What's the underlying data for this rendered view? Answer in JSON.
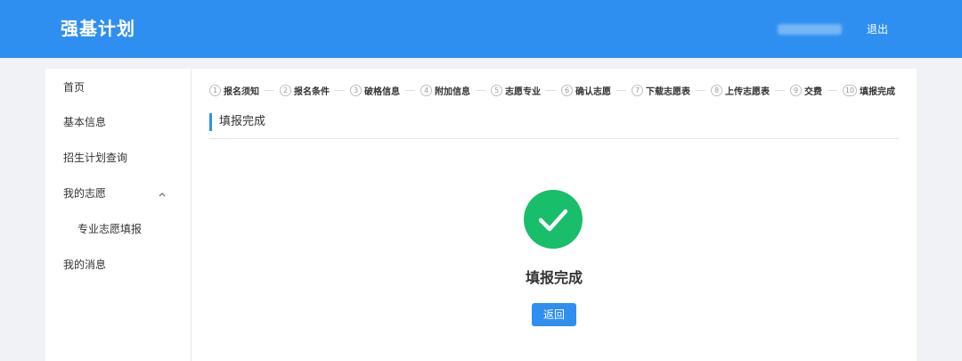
{
  "header": {
    "brand": "强基计划",
    "logout_label": "退出"
  },
  "sidebar": {
    "items": [
      {
        "label": "首页"
      },
      {
        "label": "基本信息"
      },
      {
        "label": "招生计划查询"
      },
      {
        "label": "我的志愿",
        "expanded": true
      },
      {
        "label": "专业志愿填报"
      },
      {
        "label": "我的消息"
      }
    ]
  },
  "steps": [
    {
      "num": "1",
      "label": "报名须知"
    },
    {
      "num": "2",
      "label": "报名条件"
    },
    {
      "num": "3",
      "label": "破格信息"
    },
    {
      "num": "4",
      "label": "附加信息"
    },
    {
      "num": "5",
      "label": "志愿专业"
    },
    {
      "num": "6",
      "label": "确认志愿"
    },
    {
      "num": "7",
      "label": "下载志愿表"
    },
    {
      "num": "8",
      "label": "上传志愿表"
    },
    {
      "num": "9",
      "label": "交费"
    },
    {
      "num": "10",
      "label": "填报完成"
    }
  ],
  "main": {
    "section_title": "填报完成",
    "result_text": "填报完成",
    "back_label": "返回"
  },
  "colors": {
    "primary": "#2f8ff0",
    "success": "#19be6b"
  }
}
